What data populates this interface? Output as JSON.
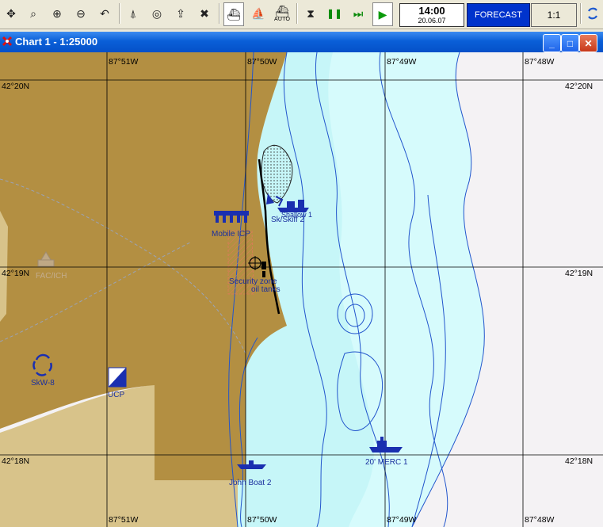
{
  "toolbar": {
    "tools": [
      {
        "name": "pan-icon",
        "glyph": "✥"
      },
      {
        "name": "zoom-window-icon",
        "glyph": "⌕"
      },
      {
        "name": "zoom-in-icon",
        "glyph": "⊕"
      },
      {
        "name": "zoom-out-icon",
        "glyph": "⊖"
      },
      {
        "name": "undo-view-icon",
        "glyph": "↶"
      },
      {
        "name": "compass-icon",
        "glyph": "⍋"
      },
      {
        "name": "target-icon",
        "glyph": "◎"
      },
      {
        "name": "export-icon",
        "glyph": "⇪"
      },
      {
        "name": "delete-icon",
        "glyph": "✖"
      },
      {
        "name": "vessel-mode-icon",
        "glyph": "⛴"
      },
      {
        "name": "ship-icon",
        "glyph": "⛵"
      },
      {
        "name": "auto-ship-icon",
        "glyph": "⛴"
      },
      {
        "name": "stop-icon",
        "glyph": "⧗"
      },
      {
        "name": "pause-icon",
        "glyph": "❚❚"
      },
      {
        "name": "fast-forward-icon",
        "glyph": "⏭"
      },
      {
        "name": "play-icon",
        "glyph": "▶"
      }
    ],
    "auto_label": "AUTO",
    "time": "14:00",
    "date": "20.06.07",
    "forecast_label": "FORECAST",
    "scale_label": "1:1",
    "refresh_icon": "refresh-icon",
    "accent_color": "#0033cc"
  },
  "window": {
    "title": "Chart 1 - 1:25000",
    "minimize_label": "_",
    "maximize_label": "□",
    "close_label": "✕"
  },
  "map": {
    "colors": {
      "land_dark": "#b38f42",
      "land_light": "#d8c38a",
      "shallow_water": "#c6f6f8",
      "water": "#d6fbfc",
      "deep_water": "#f4f2f4",
      "contour": "#2255cc",
      "grid": "#000000",
      "label": "#1a2f9e"
    },
    "longitude_labels": [
      "87°51W",
      "87°50W",
      "87°49W",
      "87°48W"
    ],
    "latitude_labels": [
      "42°20N",
      "42°19N",
      "42°18N"
    ],
    "features": [
      {
        "id": "mobile-icp",
        "label": "Mobile ICP",
        "icon": "mobile-icp-icon"
      },
      {
        "id": "security-zone",
        "label": "Security zone",
        "icon": "crosshair-icon"
      },
      {
        "id": "oil-tanks",
        "label": "oil tanks",
        "icon": "oil-tanks-icon"
      },
      {
        "id": "skw-8",
        "label": "SkW-8",
        "icon": "skimmer-icon"
      },
      {
        "id": "ucp",
        "label": "UCP",
        "icon": "ucp-icon"
      },
      {
        "id": "boat-shallow",
        "label": "Shallow 1",
        "icon": "boat-icon"
      },
      {
        "id": "boat-skiff",
        "label": "Sk/Skiff 2",
        "icon": "boat-icon"
      },
      {
        "id": "merc-1",
        "label": "20' MERC 1",
        "icon": "ship-icon"
      },
      {
        "id": "john-boat-2",
        "label": "John Boat 2",
        "icon": "boat-icon"
      },
      {
        "id": "faded-label",
        "label": "FAC/ICH",
        "icon": "faded-marker-icon"
      }
    ]
  }
}
